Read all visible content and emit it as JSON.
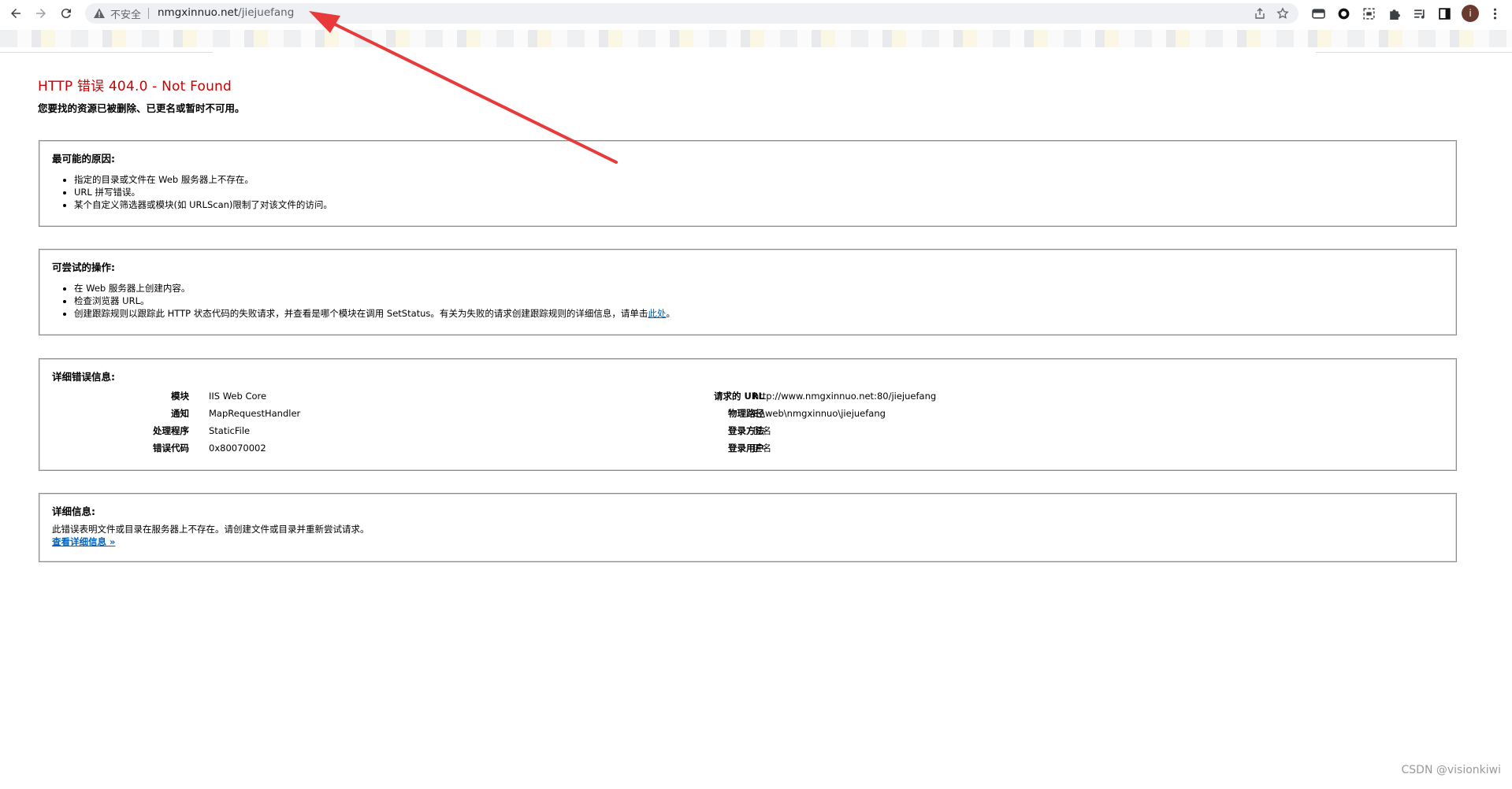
{
  "browser": {
    "insecure_label": "不安全",
    "url_host": "nmgxinnuo.net",
    "url_path": "/jiejuefang",
    "avatar_letter": "i"
  },
  "error_page": {
    "title": "HTTP 错误 404.0 - Not Found",
    "subtitle": "您要找的资源已被删除、已更名或暂时不可用。",
    "causes": {
      "heading": "最可能的原因:",
      "items": [
        "指定的目录或文件在 Web 服务器上不存在。",
        "URL 拼写错误。",
        "某个自定义筛选器或模块(如 URLScan)限制了对该文件的访问。"
      ]
    },
    "actions": {
      "heading": "可尝试的操作:",
      "items": [
        "在 Web 服务器上创建内容。",
        "检查浏览器 URL。"
      ],
      "item3_text": "创建跟踪规则以跟踪此 HTTP 状态代码的失败请求，并查看是哪个模块在调用 SetStatus。有关为失败的请求创建跟踪规则的详细信息，请单击",
      "item3_link": "此处",
      "item3_end": "。"
    },
    "error_info": {
      "heading": "详细错误信息:",
      "left": [
        {
          "key": "模块",
          "value": "IIS Web Core"
        },
        {
          "key": "通知",
          "value": "MapRequestHandler"
        },
        {
          "key": "处理程序",
          "value": "StaticFile"
        },
        {
          "key": "错误代码",
          "value": "0x80070002"
        }
      ],
      "right": [
        {
          "key": "请求的 URL",
          "value": "http://www.nmgxinnuo.net:80/jiejuefang"
        },
        {
          "key": "物理路径",
          "value": "E:\\web\\nmgxinnuo\\jiejuefang"
        },
        {
          "key": "登录方法",
          "value": "匿名"
        },
        {
          "key": "登录用户",
          "value": "匿名"
        }
      ]
    },
    "more_info": {
      "heading": "详细信息:",
      "text": "此错误表明文件或目录在服务器上不存在。请创建文件或目录并重新尝试请求。",
      "link": "查看详细信息 »"
    }
  },
  "watermark": "CSDN @visionkiwi",
  "colors": {
    "error_title": "#cc0000",
    "link": "#0563c1",
    "arrow": "#e83a3a"
  }
}
